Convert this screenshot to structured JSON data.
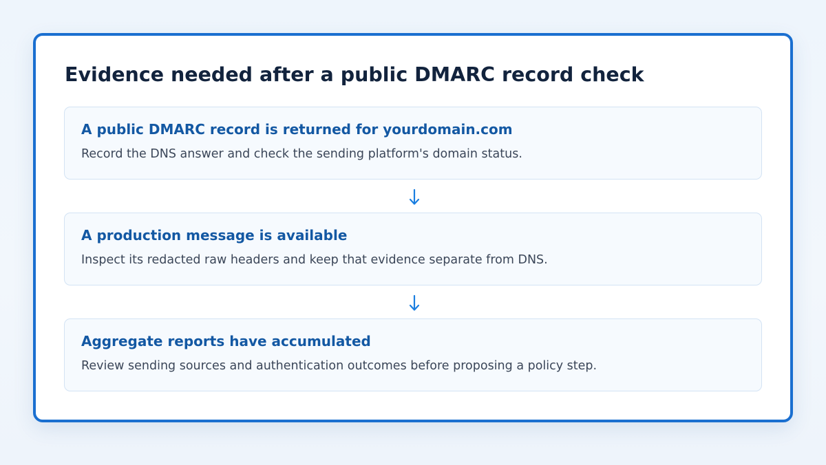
{
  "diagram": {
    "title": "Evidence needed after a public DMARC record check",
    "steps": [
      {
        "title": "A public DMARC record is returned for yourdomain.com",
        "description": "Record the DNS answer and check the sending platform's domain status."
      },
      {
        "title": "A production message is available",
        "description": "Inspect its redacted raw headers and keep that evidence separate from DNS."
      },
      {
        "title": "Aggregate reports have accumulated",
        "description": "Review sending sources and authentication outcomes before proposing a policy step."
      }
    ],
    "connector_icon": "arrow-down-icon",
    "colors": {
      "accent": "#1a6fd0",
      "step_title": "#1358a3",
      "heading": "#12233d",
      "body_text": "#3b4658",
      "step_background": "#f6fafe",
      "step_border": "#d3e3f4"
    }
  }
}
